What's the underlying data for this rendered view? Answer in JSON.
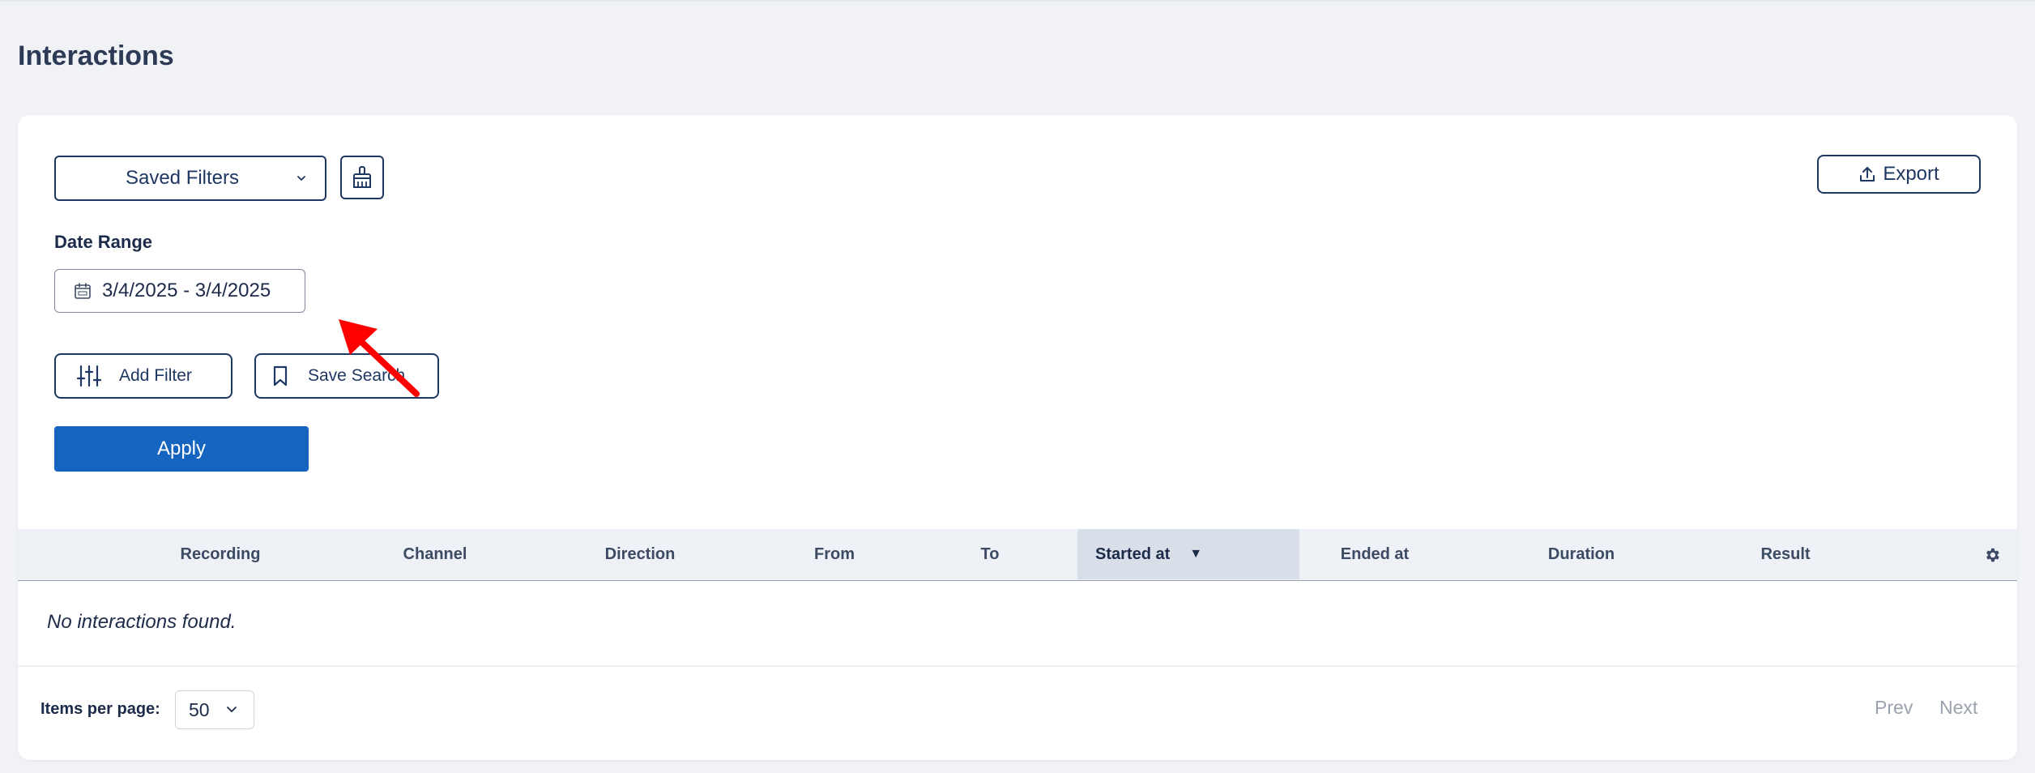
{
  "page": {
    "title": "Interactions"
  },
  "toolbar": {
    "saved_filters_label": "Saved Filters",
    "clear_icon": "broom-icon",
    "export_label": "Export",
    "export_icon": "upload-icon"
  },
  "filters": {
    "date_range_label": "Date Range",
    "date_range_value": "3/4/2025 - 3/4/2025",
    "add_filter_label": "Add Filter",
    "save_search_label": "Save Search",
    "apply_label": "Apply"
  },
  "table": {
    "columns": [
      "Recording",
      "Channel",
      "Direction",
      "From",
      "To",
      "Started at",
      "Ended at",
      "Duration",
      "Result"
    ],
    "sorted_column": "Started at",
    "sort_direction": "descending",
    "empty_message": "No interactions found."
  },
  "pagination": {
    "items_per_page_label": "Items per page:",
    "items_per_page_value": "50",
    "prev_label": "Prev",
    "next_label": "Next"
  },
  "colors": {
    "primary": "#1565c0",
    "navy": "#1f3763",
    "annotation_arrow": "#ff0000"
  }
}
